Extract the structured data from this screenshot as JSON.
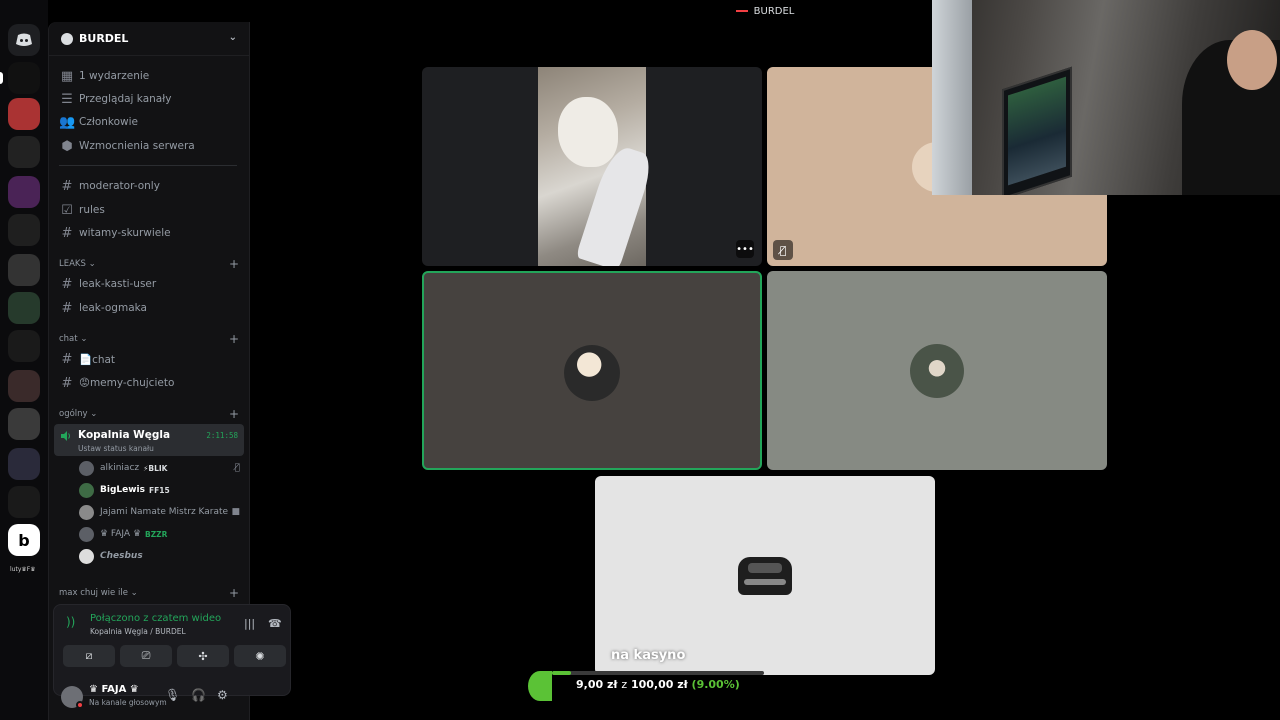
{
  "topbar": {
    "title": "BURDEL"
  },
  "rail": {
    "small_label": "luty♛F♛"
  },
  "server": {
    "name": "BURDEL"
  },
  "menu": [
    {
      "icon": "calendar-icon",
      "label": "1 wydarzenie"
    },
    {
      "icon": "browse-icon",
      "label": "Przeglądaj kanały"
    },
    {
      "icon": "members-icon",
      "label": "Członkowie"
    },
    {
      "icon": "boost-icon",
      "label": "Wzmocnienia serwera"
    }
  ],
  "channels_top": [
    {
      "label": "moderator-only"
    },
    {
      "label": "rules"
    },
    {
      "label": "witamy-skurwiele"
    }
  ],
  "categories": {
    "leaks": "LEAKS",
    "chat": "chat",
    "general": "ogólny",
    "max": "max chuj wie ile"
  },
  "leaks_channels": [
    {
      "label": "leak-kasti-user"
    },
    {
      "label": "leak-ogmaka"
    }
  ],
  "chat_channels": [
    {
      "label": "📄chat"
    },
    {
      "label": "😡memy-chujcieto"
    }
  ],
  "voice_channel": {
    "name": "Kopalnia Węgla",
    "timer": "2:11:58",
    "status": "Ustaw status kanału"
  },
  "voice_users": [
    {
      "name": "alkiniacz",
      "tag": "⚡BLIK",
      "right": "mute"
    },
    {
      "name": "BigLewis",
      "tag": "FF15",
      "right": ""
    },
    {
      "name": "Jajami Namate Mistrz Karate",
      "tag": "",
      "right": "video"
    },
    {
      "name": "♛ FAJA ♛",
      "tag": "BZZR",
      "right": ""
    },
    {
      "name": "𝘾𝙝𝙚𝙨𝙗𝙪𝙨",
      "tag": "",
      "right": ""
    }
  ],
  "connection": {
    "title": "Połączono z czatem wideo",
    "subtitle": "Kopalnia Węgla / BURDEL"
  },
  "user": {
    "name": "♛ FAJA ♛",
    "status": "Na kanale głosowym"
  },
  "caption": "na kasyno",
  "goal": {
    "current": "9,00 zł",
    "sep": "z",
    "target": "100,00 zł",
    "percent": "(9.00%)",
    "fraction": 0.09,
    "color": "#5bc236"
  }
}
